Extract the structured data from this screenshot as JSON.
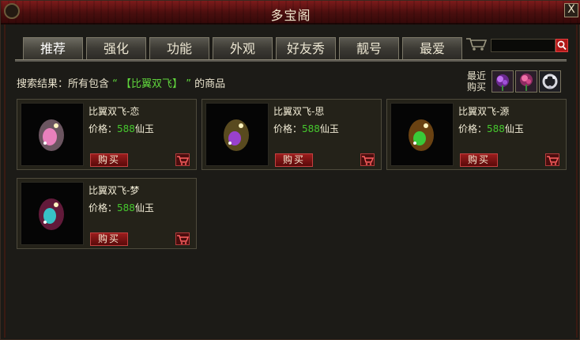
{
  "window": {
    "title": "多宝阁",
    "close_label": "X"
  },
  "tabs": [
    {
      "label": "推荐"
    },
    {
      "label": "强化"
    },
    {
      "label": "功能"
    },
    {
      "label": "外观"
    },
    {
      "label": "好友秀"
    },
    {
      "label": "靓号"
    },
    {
      "label": "最爱"
    }
  ],
  "search": {
    "value": "",
    "placeholder": ""
  },
  "result": {
    "prefix": "搜索结果：所有包含",
    "open_quote": "“",
    "query": "【比翼双飞】",
    "close_quote": "”",
    "suffix": "的商品"
  },
  "recent": {
    "label_line1": "最近",
    "label_line2": "购买",
    "items": [
      {
        "icon": "purple-flower-icon",
        "color": "#8a3cb0"
      },
      {
        "icon": "pink-flower-icon",
        "color": "#c0508a"
      },
      {
        "icon": "white-wreath-icon",
        "color": "#c8c8d0"
      }
    ]
  },
  "products": [
    {
      "name": "比翼双飞-恋",
      "price_label": "价格：",
      "price": "588",
      "currency": "仙玉",
      "buy_label": "购买",
      "glow": "#e8b8d0",
      "core": "#ff88cc"
    },
    {
      "name": "比翼双飞-思",
      "price_label": "价格：",
      "price": "588",
      "currency": "仙玉",
      "buy_label": "购买",
      "glow": "#c0a040",
      "core": "#a040e0"
    },
    {
      "name": "比翼双飞-源",
      "price_label": "价格：",
      "price": "588",
      "currency": "仙玉",
      "buy_label": "购买",
      "glow": "#d08020",
      "core": "#30e040"
    },
    {
      "name": "比翼双飞-梦",
      "price_label": "价格：",
      "price": "588",
      "currency": "仙玉",
      "buy_label": "购买",
      "glow": "#c03070",
      "core": "#30e0e0"
    }
  ]
}
